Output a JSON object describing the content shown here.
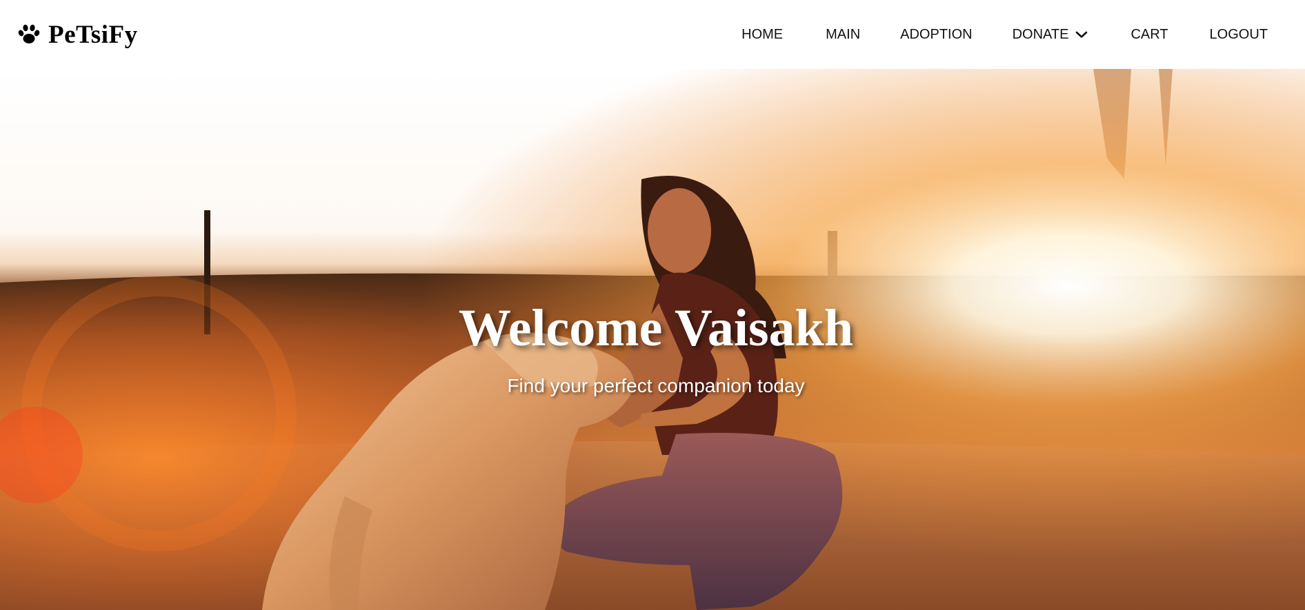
{
  "brand": {
    "name": "PeTsiFy",
    "icon": "paw-icon"
  },
  "nav": {
    "home": "HOME",
    "main": "MAIN",
    "adoption": "ADOPTION",
    "donate": "DONATE",
    "donate_icon": "chevron-down-icon",
    "cart": "CART",
    "logout": "LOGOUT"
  },
  "hero": {
    "title": "Welcome Vaisakh",
    "subtitle": "Find your perfect companion today",
    "image": "woman-with-dog-at-sunset"
  },
  "colors": {
    "nav_background": "#ffffff",
    "nav_text": "#111111",
    "hero_text": "#ffffff",
    "sunset_orange": "#e8822d"
  }
}
